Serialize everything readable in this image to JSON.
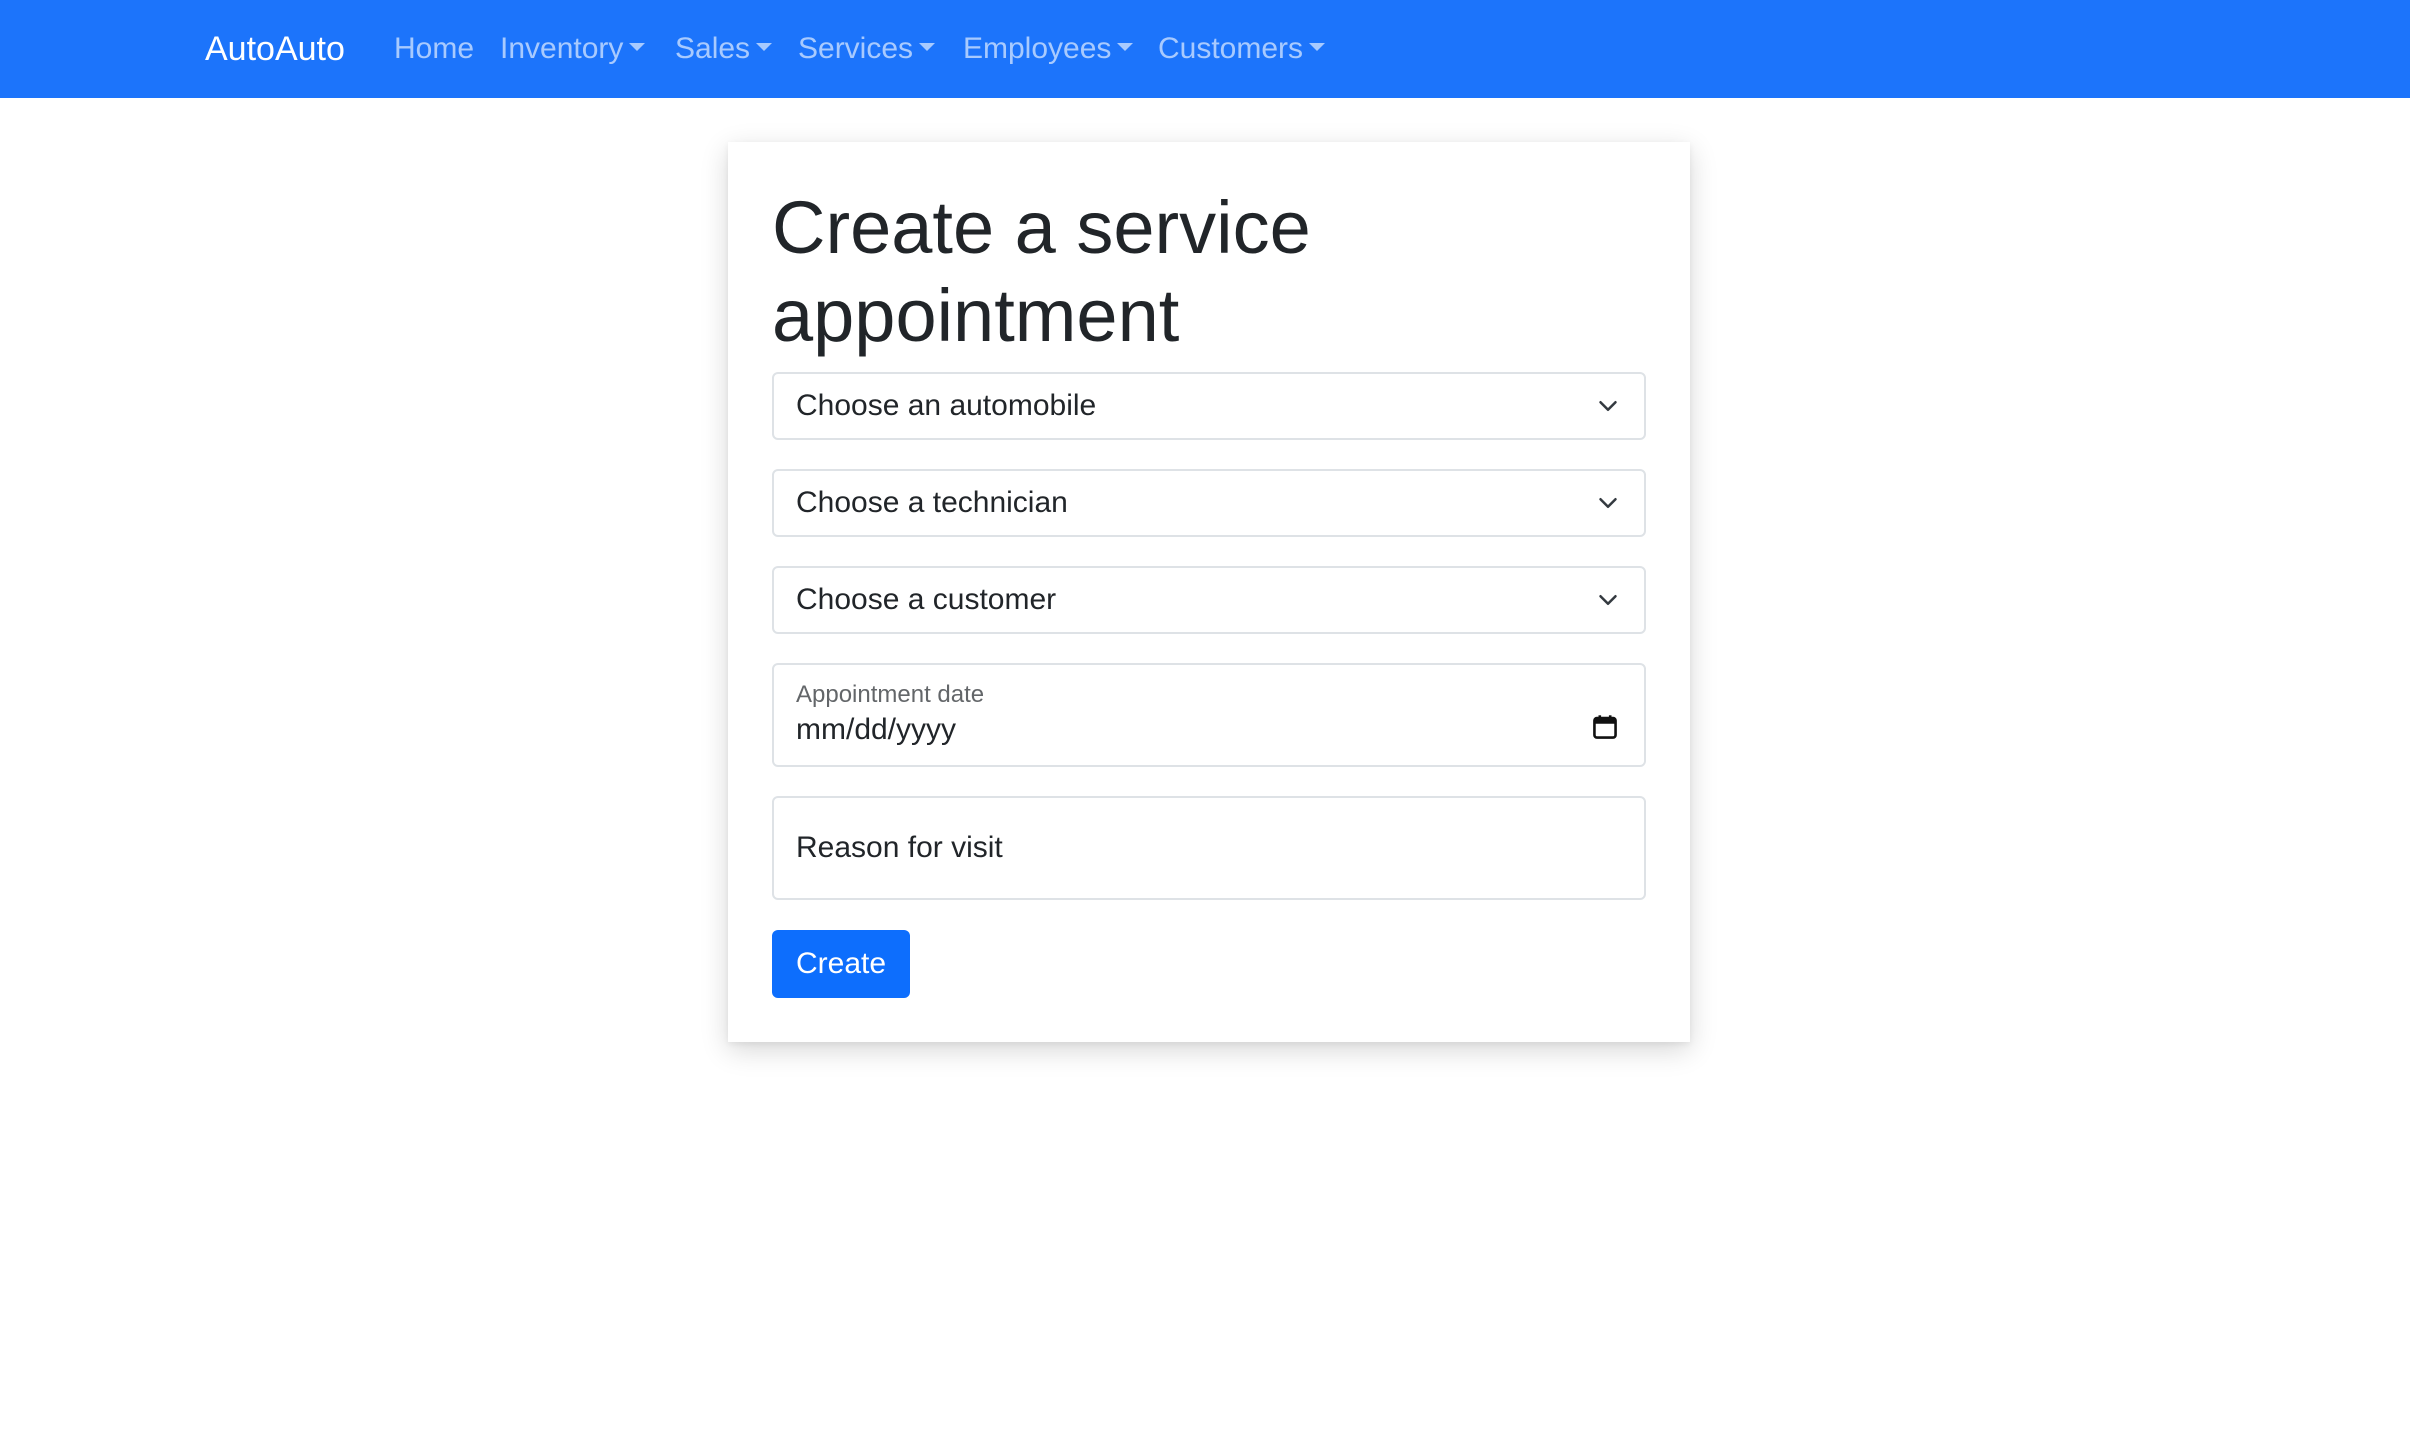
{
  "navbar": {
    "brand": "AutoAuto",
    "items": [
      {
        "label": "Home",
        "dropdown": false
      },
      {
        "label": "Inventory",
        "dropdown": true
      },
      {
        "label": "Sales",
        "dropdown": true
      },
      {
        "label": "Services",
        "dropdown": true
      },
      {
        "label": "Employees",
        "dropdown": true
      },
      {
        "label": "Customers",
        "dropdown": true
      }
    ],
    "color": "#1c74fb"
  },
  "form": {
    "title": "Create a service appointment",
    "automobile_select": "Choose an automobile",
    "technician_select": "Choose a technician",
    "customer_select": "Choose a customer",
    "date_label": "Appointment date",
    "date_placeholder": "mm/dd/yyyy",
    "reason_placeholder": "Reason for visit",
    "submit_label": "Create"
  },
  "icons": {
    "select_arrow": "chevron-down-icon",
    "date_picker": "calendar-icon"
  },
  "colors": {
    "primary": "#0d6efd"
  }
}
